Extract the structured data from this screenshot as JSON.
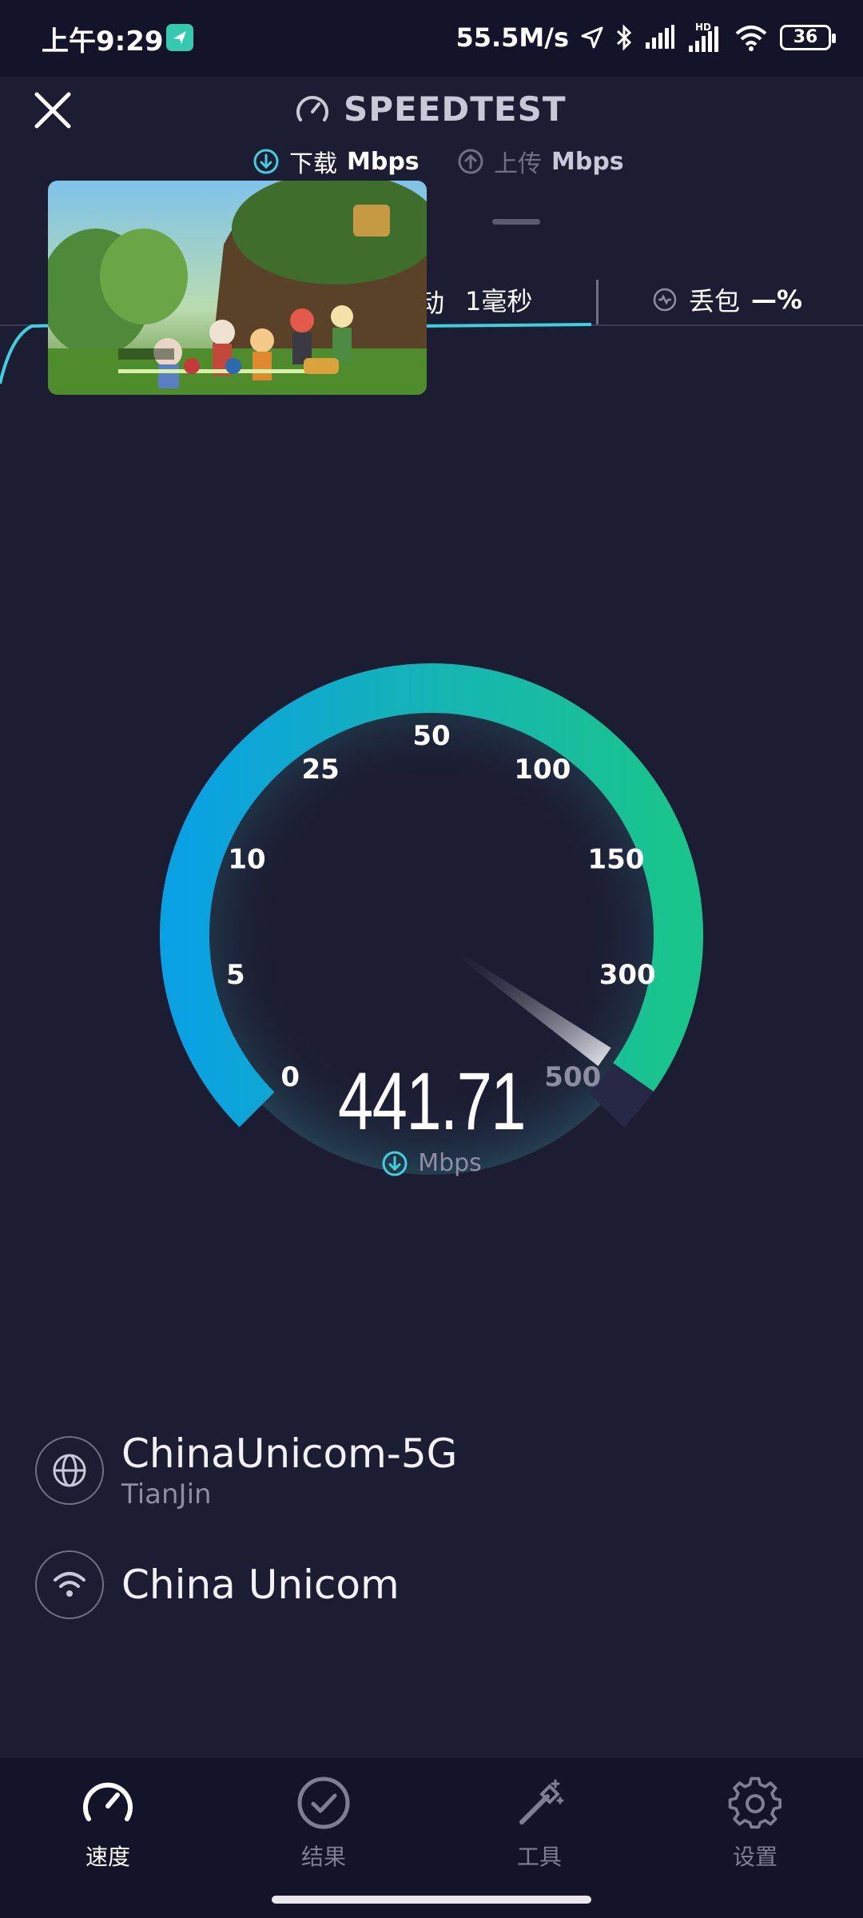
{
  "status_bar": {
    "time": "上午9:29",
    "network_speed": "55.5M/s",
    "battery": "36"
  },
  "header": {
    "title": "SPEEDTEST"
  },
  "tabs": {
    "download_label": "下载",
    "download_unit": "Mbps",
    "upload_label": "上传",
    "upload_unit": "Mbps"
  },
  "stats": {
    "jitter_label": "动",
    "jitter_value": "1毫秒",
    "loss_label": "丢包",
    "loss_value": "—%"
  },
  "gauge": {
    "ticks": [
      "0",
      "5",
      "10",
      "25",
      "50",
      "100",
      "150",
      "300",
      "500"
    ],
    "value": "441.71",
    "unit": "Mbps",
    "colors": {
      "start": "#0aa1e3",
      "end": "#19c58c",
      "needle": "#d8d9e4",
      "track": "#262845"
    }
  },
  "server": {
    "name": "ChinaUnicom-5G",
    "location": "TianJin"
  },
  "provider": {
    "name": "China Unicom"
  },
  "nav": {
    "items": [
      {
        "label": "速度"
      },
      {
        "label": "结果"
      },
      {
        "label": "工具"
      },
      {
        "label": "设置"
      }
    ]
  },
  "colors": {
    "background": "#1c1d33",
    "accent_cyan": "#3fd0e0",
    "nav_background": "#13142a"
  }
}
